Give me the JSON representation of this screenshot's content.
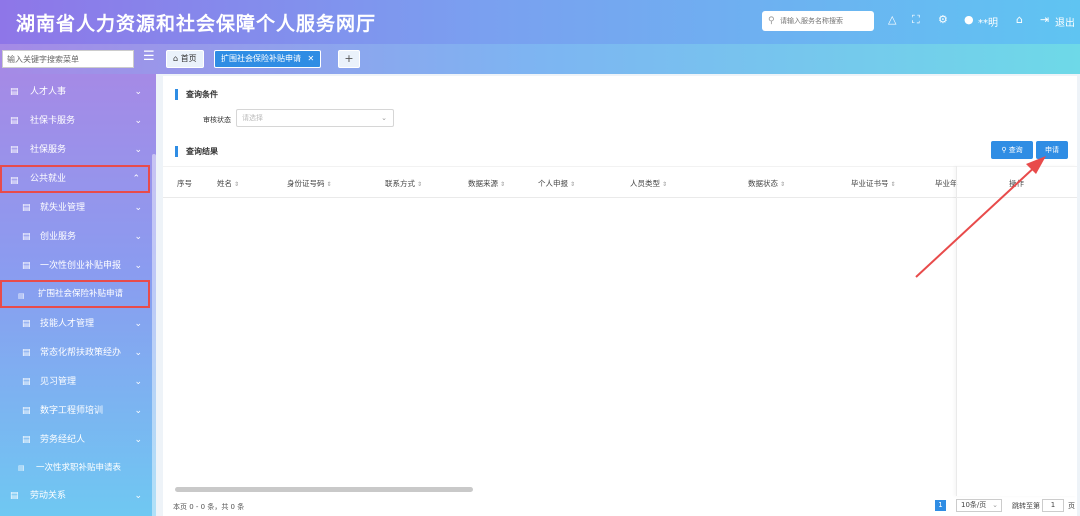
{
  "header": {
    "title": "湖南省人力资源和社会保障个人服务网厅",
    "search_placeholder": "请输入服务名称搜索",
    "user_name": "**明",
    "logout_label": "退出",
    "icons": [
      "bell-icon",
      "fullscreen-icon",
      "settings-icon",
      "user-icon",
      "home-icon",
      "logout-icon"
    ]
  },
  "tabbar": {
    "menu_search_value": "输入关键字搜索菜单",
    "home_tab": "首页",
    "active_tab": "扩围社会保险补贴申请",
    "add_tab": "+"
  },
  "sidebar": {
    "items": [
      {
        "label": "人才人事"
      },
      {
        "label": "社保卡服务"
      },
      {
        "label": "社保服务"
      },
      {
        "label": "公共就业"
      },
      {
        "label": "就失业管理"
      },
      {
        "label": "创业服务"
      },
      {
        "label": "一次性创业补贴申报"
      },
      {
        "label": "扩围社会保险补贴申请"
      },
      {
        "label": "技能人才管理"
      },
      {
        "label": "常态化帮扶政策经办"
      },
      {
        "label": "见习管理"
      },
      {
        "label": "数字工程师培训"
      },
      {
        "label": "劳务经纪人"
      },
      {
        "label": "一次性求职补贴申请表"
      },
      {
        "label": "劳动关系"
      }
    ]
  },
  "main": {
    "query_conditions_title": "查询条件",
    "audit_status_label": "审核状态",
    "audit_status_placeholder": "请选择",
    "query_results_title": "查询结果",
    "query_button": "查询",
    "apply_button": "申请",
    "columns": [
      "序号",
      "姓名",
      "身份证号码",
      "联系方式",
      "数据来源",
      "个人申报",
      "人员类型",
      "数据状态",
      "毕业证书号",
      "毕业年",
      "操作"
    ],
    "footer": {
      "summary": "本页 0 - 0 条，共 0 条",
      "current_page": "1",
      "page_size": "10条/页",
      "jump_label": "跳转至第",
      "jump_value": "1",
      "jump_unit": "页"
    }
  },
  "colors": {
    "accent": "#2f8de4",
    "highlight_box": "#e84b4b",
    "annotation_arrow": "#e84b4b"
  }
}
